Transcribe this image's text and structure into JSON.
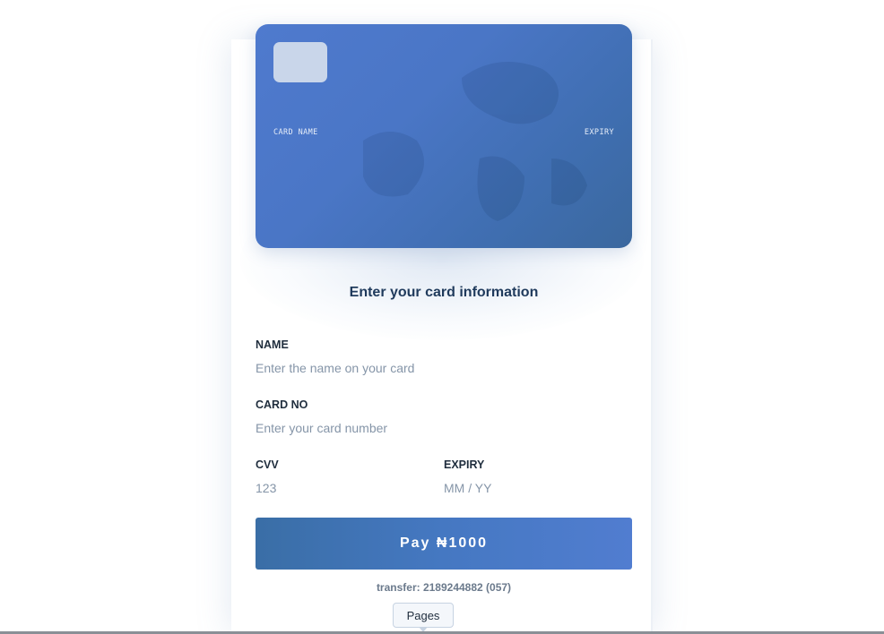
{
  "card": {
    "name_label": "CARD NAME",
    "expiry_label": "EXPIRY"
  },
  "form": {
    "heading": "Enter your card information",
    "name": {
      "label": "NAME",
      "value": "",
      "placeholder": "Enter the name on your card"
    },
    "card_no": {
      "label": "CARD NO",
      "value": "",
      "placeholder": "Enter your card number"
    },
    "cvv": {
      "label": "CVV",
      "value": "",
      "placeholder": "123"
    },
    "expiry": {
      "label": "EXPIRY",
      "value": "",
      "placeholder": "MM / YY"
    },
    "pay_label": "Pay ₦1000",
    "transfer_text": "transfer: 2189244882 (057)"
  },
  "footer": {
    "pages_label": "Pages"
  },
  "colors": {
    "card_gradient_start": "#4f7ace",
    "card_gradient_end": "#3b689e",
    "button_gradient_start": "#3a6ea6",
    "button_gradient_end": "#517dd0",
    "heading": "#1f3a5c"
  }
}
